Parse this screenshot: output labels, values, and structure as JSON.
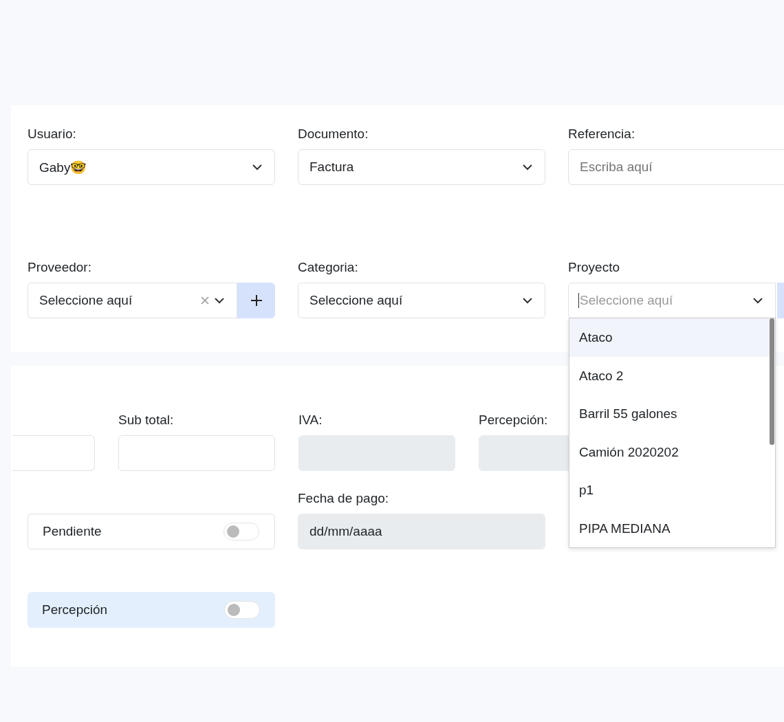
{
  "header_fields": [
    {
      "label": "Usuario:",
      "kind": "select",
      "value": "Gaby🤓"
    },
    {
      "label": "Documento:",
      "kind": "select",
      "value": "Factura"
    },
    {
      "label": "Referencia:",
      "kind": "text",
      "placeholder": "Escriba aquí"
    }
  ],
  "lookup_fields": [
    {
      "label": "Proveedor:",
      "kind": "select-add",
      "placeholder": "Seleccione aquí"
    },
    {
      "label": "Categoria:",
      "kind": "select",
      "placeholder": "Seleccione aquí"
    },
    {
      "label": "Proyecto",
      "kind": "search",
      "placeholder": "Seleccione aquí",
      "options": [
        {
          "label": "Ataco",
          "selected": true
        },
        {
          "label": "Ataco 2",
          "selected": false
        },
        {
          "label": "Barril 55 galones",
          "selected": false
        },
        {
          "label": "Camión 2020202",
          "selected": false
        },
        {
          "label": "p1",
          "selected": false
        },
        {
          "label": "PIPA MEDIANA",
          "selected": false
        }
      ]
    }
  ],
  "amounts": [
    {
      "kind": "text"
    },
    {
      "label": "Sub total:",
      "kind": "text"
    },
    {
      "label": "IVA:",
      "kind": "readonly"
    },
    {
      "label": "Percepción:",
      "kind": "readonly"
    }
  ],
  "payment_date": {
    "label": "Fecha de pago:",
    "placeholder": "dd/mm/aaaa"
  },
  "switches": [
    {
      "label": "Pendiente",
      "kind": "plain",
      "checked": false
    },
    {
      "label": "Percepción",
      "kind": "tinted",
      "checked": false
    }
  ]
}
